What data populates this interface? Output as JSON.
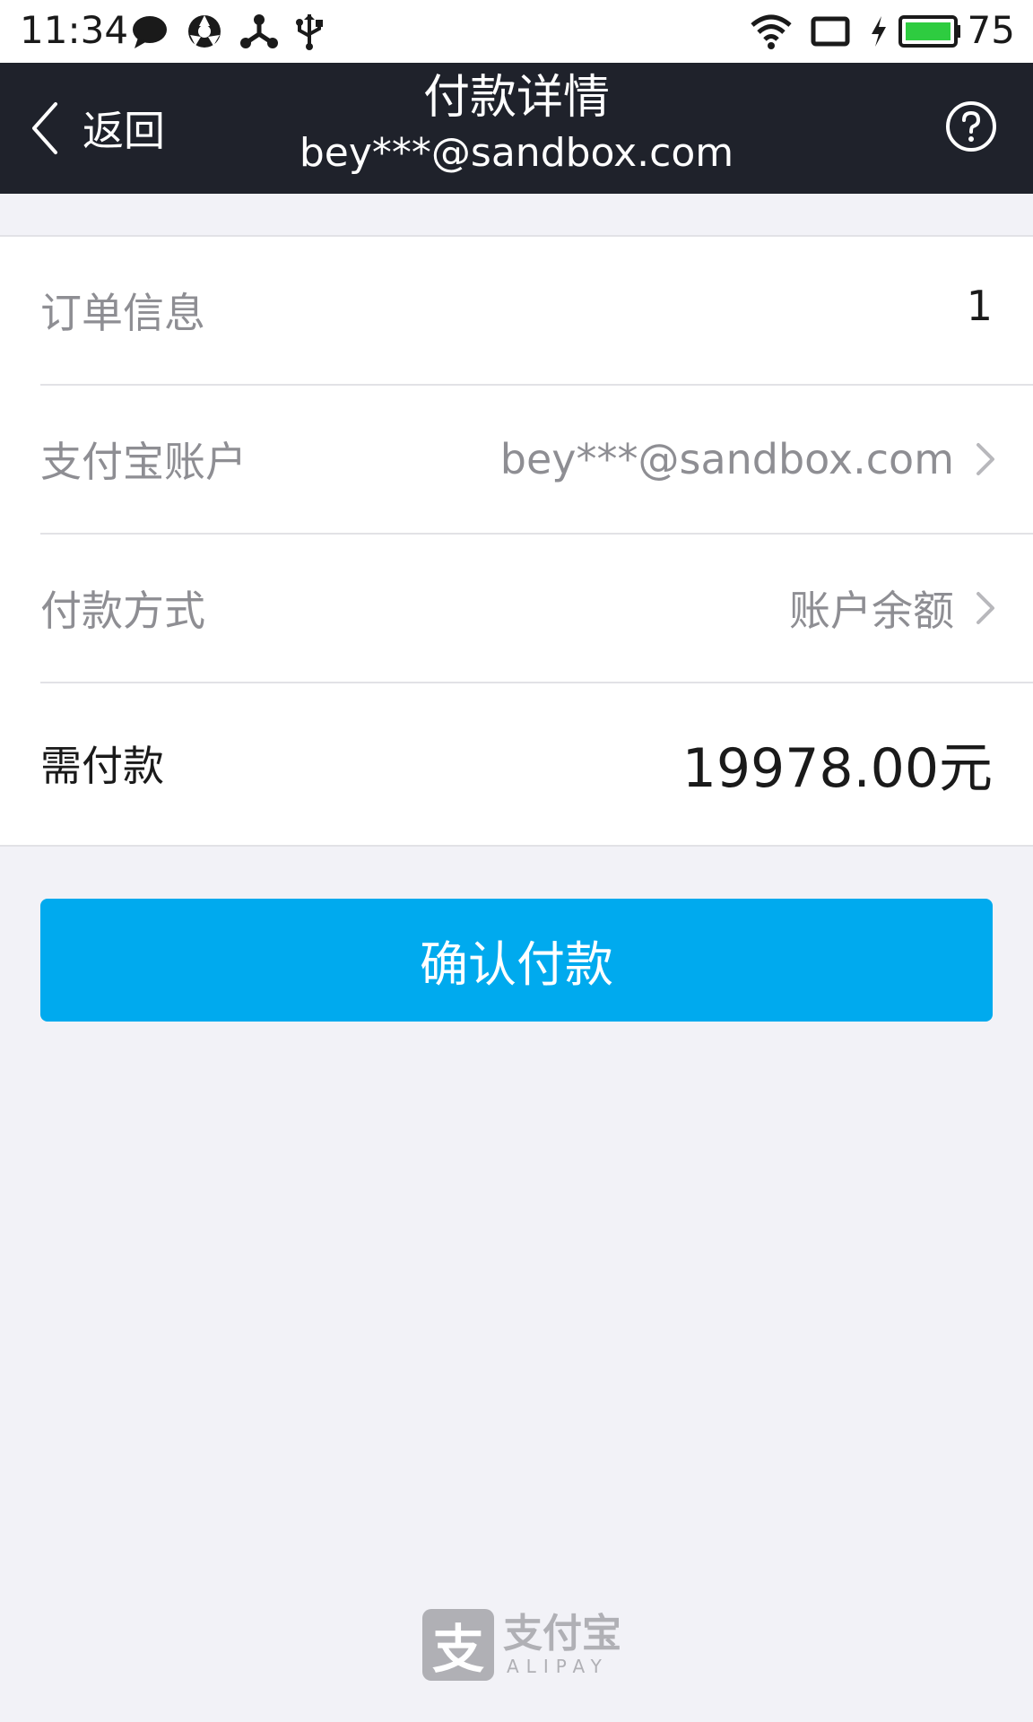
{
  "status_bar": {
    "time": "11:34",
    "battery_level": "75",
    "icons": [
      "message-icon",
      "app-icon",
      "share-icon",
      "usb-icon",
      "wifi-icon",
      "screen-icon",
      "charging-icon",
      "battery-icon"
    ]
  },
  "nav": {
    "back_label": "返回",
    "title": "付款详情",
    "subtitle": "bey***@sandbox.com"
  },
  "rows": {
    "order_label": "订单信息",
    "order_value": "1",
    "account_label": "支付宝账户",
    "account_value": "bey***@sandbox.com",
    "method_label": "付款方式",
    "method_value": "账户余额",
    "amount_label": "需付款",
    "amount_value": "19978.00元"
  },
  "confirm_button": "确认付款",
  "footer": {
    "logo_mark": "支",
    "logo_cn": "支付宝",
    "logo_en": "ALIPAY"
  },
  "colors": {
    "nav_background": "#1f222b",
    "confirm_button": "#00aaee",
    "page_background": "#f2f2f7",
    "battery": "#2ecc40"
  }
}
